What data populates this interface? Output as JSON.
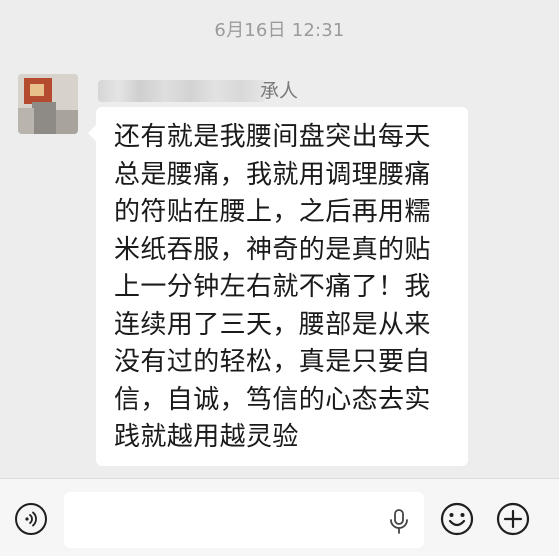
{
  "chat": {
    "timestamp": "6月16日 12:31",
    "message": {
      "sender_name_visible": "承人",
      "lines": [
        "还有就是我腰间盘突出每天",
        "总是腰痛，我就用调理腰痛",
        "的符贴在腰上，之后再用糯",
        "米纸吞服，神奇的是真的贴",
        "上一分钟左右就不痛了！我",
        "连续用了三天，腰部是从来",
        "没有过的轻松，真是只要自",
        "信，自诚，笃信的心态去实",
        "践就越用越灵验"
      ]
    }
  },
  "input_bar": {
    "text_value": "",
    "icons": {
      "voice": "voice-mode-icon",
      "mic": "microphone-icon",
      "emoji": "emoji-icon",
      "more": "plus-icon"
    }
  },
  "colors": {
    "chat_background": "#ededed",
    "bubble": "#ffffff",
    "input_bar": "#f6f6f6",
    "timestamp": "#9b9b9b"
  }
}
